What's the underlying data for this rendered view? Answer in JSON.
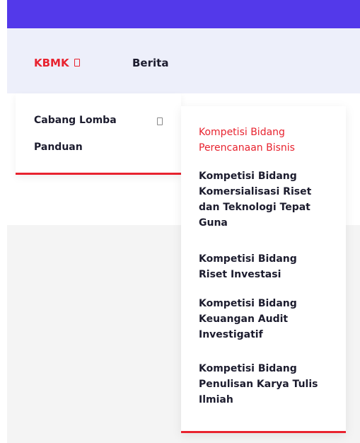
{
  "navbar": {
    "items": [
      {
        "label": "KBMK",
        "icon": "missing-glyph-icon"
      },
      {
        "label": "Berita"
      }
    ]
  },
  "submenu": {
    "items": [
      {
        "label": "Cabang Lomba",
        "icon": "missing-glyph-icon"
      },
      {
        "label": "Panduan"
      }
    ]
  },
  "cabang_lomba_menu": {
    "items": [
      {
        "label": "Kompetisi Bidang\nPerencanaan Bisnis",
        "active": true
      },
      {
        "label": "Kompetisi Bidang\nKomersialisasi Riset\ndan Teknologi Tepat\nGuna"
      },
      {
        "label": "Kompetisi Bidang\nRiset Investasi"
      },
      {
        "label": "Kompetisi Bidang\nKeuangan Audit\nInvestigatif"
      },
      {
        "label": "Kompetisi Bidang\nPenulisan Karya Tulis\nIlmiah"
      }
    ]
  },
  "colors": {
    "topbar": "#5339ea",
    "navbar_bg": "#edeffa",
    "accent": "#e8232f",
    "text": "#1c1c2e"
  }
}
